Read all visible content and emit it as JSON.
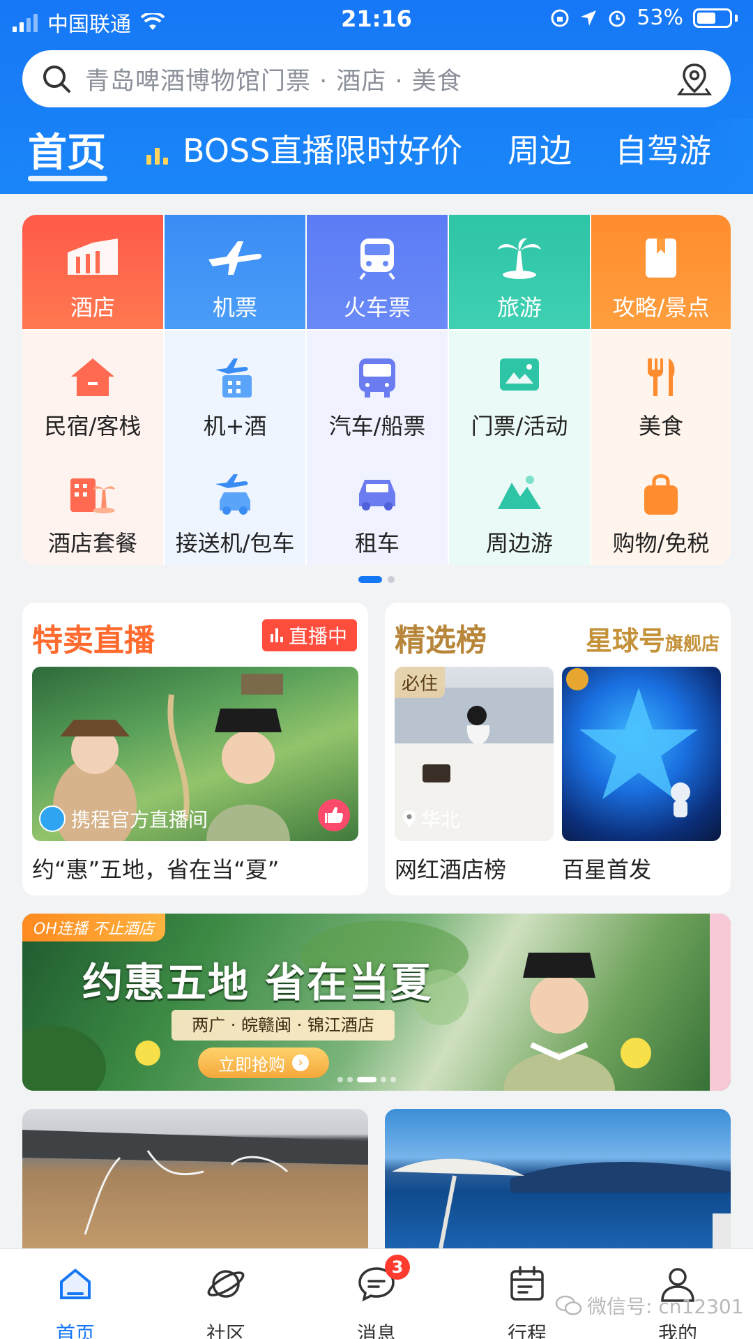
{
  "status_bar": {
    "carrier": "中国联通",
    "time": "21:16",
    "battery": "53%"
  },
  "search": {
    "placeholder": "青岛啤酒博物馆门票 · 酒店 · 美食"
  },
  "top_tabs": [
    "首页",
    "BOSS直播限时好价",
    "周边",
    "自驾游"
  ],
  "categories": {
    "row1": [
      "酒店",
      "机票",
      "火车票",
      "旅游",
      "攻略/景点"
    ],
    "row2": [
      "民宿/客栈",
      "机+酒",
      "汽车/船票",
      "门票/活动",
      "美食"
    ],
    "row3": [
      "酒店套餐",
      "接送机/包车",
      "租车",
      "周边游",
      "购物/免税"
    ]
  },
  "live_card": {
    "title": "特卖直播",
    "badge": "直播中",
    "caption": "携程官方直播间",
    "desc": "约“惠”五地，省在当“夏”"
  },
  "rank_card": {
    "title": "精选榜",
    "flagship_main": "星球号",
    "flagship_sub": "旗舰店",
    "tag": "必住",
    "location": "华北",
    "items": [
      "网红酒店榜",
      "百星首发"
    ]
  },
  "banner": {
    "tag": "OH连播 不止酒店",
    "title": "约惠五地 省在当夏",
    "subtitle": "两广 · 皖赣闽 · 锦江酒店",
    "button": "立即抢购"
  },
  "bottom_nav": [
    "首页",
    "社区",
    "消息",
    "行程",
    "我的"
  ],
  "message_badge": "3",
  "watermark": "微信号: cn12301",
  "colors": {
    "brand_blue": "#1677f6",
    "hotel": "#ff5a4a",
    "flight": "#3a8cf5",
    "train": "#5b7cf5",
    "travel": "#2ec4a6",
    "guide": "#ff8c2e",
    "badge_red": "#ff3b30"
  }
}
